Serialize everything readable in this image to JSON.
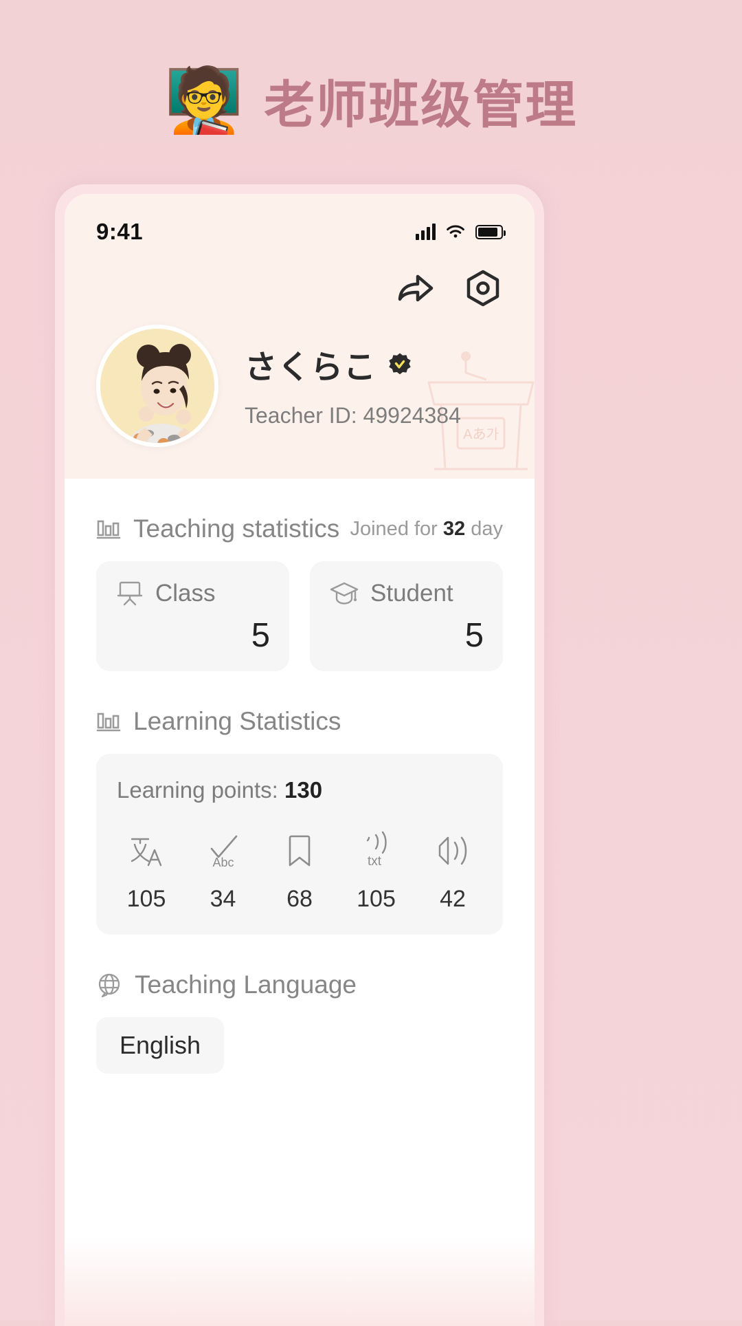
{
  "header": {
    "emoji": "🧑‍🏫",
    "emoji_name": "teacher-emoji",
    "title": "老师班级管理",
    "title_color": "#bd7b88"
  },
  "status_bar": {
    "time": "9:41",
    "icons": [
      "cellular-signal-icon",
      "wifi-icon",
      "battery-icon"
    ]
  },
  "hero": {
    "actions": [
      {
        "name": "share-icon",
        "label": "Share"
      },
      {
        "name": "settings-icon",
        "label": "Settings"
      }
    ],
    "avatar_name": "user-avatar",
    "name": "さくらこ",
    "verified_badge": "verified-badge-icon",
    "verified_badge_color": "#f5e05e",
    "teacher_id_label": "Teacher ID: 49924384",
    "decoration": "podium-illustration"
  },
  "teaching_statistics": {
    "icon": "bar-chart-icon",
    "title": "Teaching statistics",
    "joined_prefix": "Joined for ",
    "joined_value": "32",
    "joined_suffix": " day",
    "cards": [
      {
        "icon": "whiteboard-icon",
        "label": "Class",
        "value": "5"
      },
      {
        "icon": "graduation-cap-icon",
        "label": "Student",
        "value": "5"
      }
    ]
  },
  "learning_statistics": {
    "icon": "bar-chart-icon",
    "title": "Learning Statistics",
    "points_label": "Learning points: ",
    "points_value": "130",
    "items": [
      {
        "icon": "translate-icon",
        "value": "105"
      },
      {
        "icon": "spellcheck-icon",
        "value": "34"
      },
      {
        "icon": "bookmark-icon",
        "value": "68"
      },
      {
        "icon": "text-to-speech-icon",
        "value": "105"
      },
      {
        "icon": "speaker-icon",
        "value": "42"
      }
    ]
  },
  "teaching_language": {
    "icon": "globe-icon",
    "title": "Teaching Language",
    "selected": "English"
  },
  "colors": {
    "page_background": "#f3d2d6",
    "hero_background": "#fdf1ec",
    "card_background": "#f6f6f6",
    "accent": "#bd7b88"
  }
}
